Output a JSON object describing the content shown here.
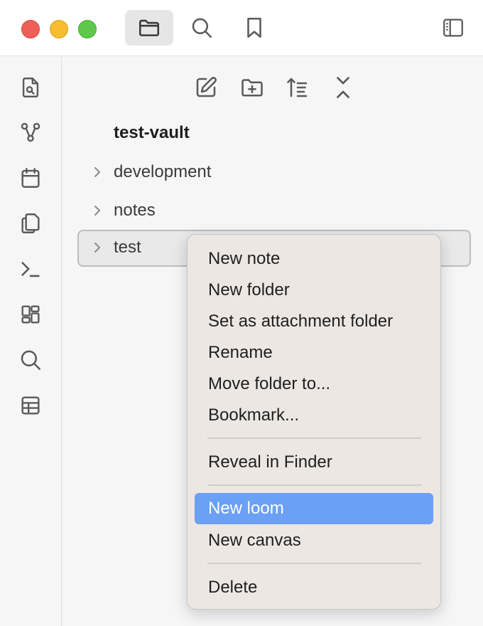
{
  "titlebar": {
    "buttons": [
      {
        "icon": "folder-icon",
        "active": true
      },
      {
        "icon": "search-icon",
        "active": false
      },
      {
        "icon": "bookmark-icon",
        "active": false
      }
    ],
    "right_icon": "sidebar-toggle-icon"
  },
  "ribbon": {
    "icons": [
      "file-search-icon",
      "graph-icon",
      "calendar-icon",
      "copy-icon",
      "terminal-icon",
      "dashboard-icon",
      "search-icon",
      "table-icon"
    ]
  },
  "explorer": {
    "nav_icons": [
      "new-note-icon",
      "new-folder-icon",
      "sort-icon",
      "collapse-icon"
    ],
    "vault_name": "test-vault",
    "items": [
      {
        "label": "development",
        "selected": false
      },
      {
        "label": "notes",
        "selected": false
      },
      {
        "label": "test",
        "selected": true
      }
    ]
  },
  "context_menu": {
    "items": [
      {
        "label": "New note"
      },
      {
        "label": "New folder"
      },
      {
        "label": "Set as attachment folder"
      },
      {
        "label": "Rename"
      },
      {
        "label": "Move folder to..."
      },
      {
        "label": "Bookmark..."
      },
      {
        "label": "Reveal in Finder"
      },
      {
        "label": "New loom",
        "highlighted": true
      },
      {
        "label": "New canvas"
      },
      {
        "label": "Delete"
      }
    ]
  },
  "colors": {
    "highlight": "#6aa0f5",
    "icon": "#5a5a5a",
    "close": "#ee5f57",
    "minimize": "#f6bd2f",
    "maximize": "#5ec84a"
  }
}
